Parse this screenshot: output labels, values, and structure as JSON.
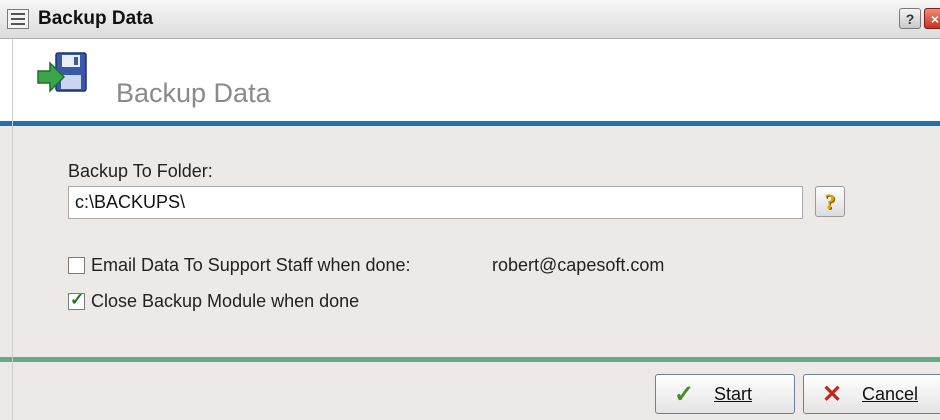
{
  "window": {
    "title": "Backup Data",
    "help_glyph": "?",
    "close_glyph": "×"
  },
  "header": {
    "title": "Backup Data",
    "icon": "floppy-disk-backup-icon"
  },
  "form": {
    "folder_label": "Backup To Folder:",
    "folder_value": "c:\\BACKUPS\\",
    "lookup_glyph": "?",
    "email_option": {
      "label": "Email Data To Support Staff when done:",
      "checked": false,
      "address": "robert@capesoft.com"
    },
    "close_option": {
      "label": "Close Backup Module when done",
      "checked": true,
      "tick": "✓"
    }
  },
  "buttons": {
    "start": {
      "label": "Start",
      "glyph": "✓"
    },
    "cancel": {
      "label": "Cancel",
      "glyph": "✕"
    }
  },
  "colors": {
    "accent_blue": "#1e73b6",
    "divider_green": "#6aa88a",
    "start_icon": "#4a8a2a",
    "cancel_icon": "#c0261a"
  }
}
